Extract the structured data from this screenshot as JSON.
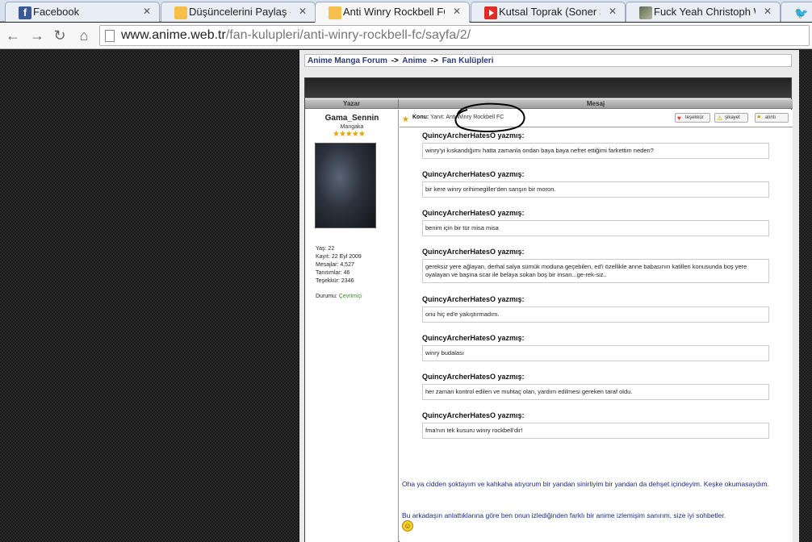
{
  "tabs": [
    {
      "title": "Facebook",
      "icon": "facebook-icon",
      "active": false
    },
    {
      "title": "Düşüncelerini Paylaş - Kor",
      "icon": "anime-site-icon",
      "active": false
    },
    {
      "title": "Anti Winry Rockbell FC - F",
      "icon": "anime-site-icon",
      "active": true
    },
    {
      "title": "Kutsal Toprak (Soner Sarık",
      "icon": "youtube-icon",
      "active": false
    },
    {
      "title": "Fuck Yeah Christoph Walt",
      "icon": "photo-favicon",
      "active": false
    },
    {
      "title": "",
      "icon": "twitter-icon",
      "active": false
    }
  ],
  "address": {
    "host": "www.anime.web.tr",
    "path": "/fan-kulupleri/anti-winry-rockbell-fc/sayfa/2/"
  },
  "breadcrumb": {
    "items": [
      "Anime Manga Forum",
      "Anime",
      "Fan Kulüpleri"
    ],
    "separator": "->"
  },
  "table": {
    "author_header": "Yazar",
    "message_header": "Mesaj"
  },
  "author": {
    "name": "Gama_Sennin",
    "rank": "Mangaka",
    "stars": "★★★★★",
    "stats": [
      "Yaş: 22",
      "Kayıt: 22 Eyl 2009",
      "Mesajlar: 4,527",
      "Tanıtımlar: 46",
      "Teşekkür: 2346"
    ],
    "status_label": "Durumu:",
    "status_value": "Çevrimiçi"
  },
  "post": {
    "subject_label": "Konu:",
    "subject_text": "Yanıt: Anti Winry Rockbell FC",
    "buttons": {
      "thanks": "teşekkür",
      "report": "şikayet",
      "quote": "alıntı"
    },
    "quotes": [
      {
        "author": "QuincyArcherHatesO yazmış:",
        "text": "winry'yi kıskandığımı hatta zamanla ondan baya baya nefret ettiğimi farkettim neden?"
      },
      {
        "author": "QuincyArcherHatesO yazmış:",
        "text": "bir kere winry orihimegiller'den sarışın bir moron."
      },
      {
        "author": "QuincyArcherHatesO yazmış:",
        "text": "benim için bir tür misa misa"
      },
      {
        "author": "QuincyArcherHatesO yazmış:",
        "text": "gereksiz yere ağlayan, derhal salya sümük moduna geçebilen, ed'i özellikle anne babasının katilleri konusunda boş yere oyalayan ve başına scar ile belaya sokan boş bir insan...ge-rek-siz.."
      },
      {
        "author": "QuincyArcherHatesO yazmış:",
        "text": "onu hiç ed'e yakıştırmadım."
      },
      {
        "author": "QuincyArcherHatesO yazmış:",
        "text": "winry budalası"
      },
      {
        "author": "QuincyArcherHatesO yazmış:",
        "text": "her zaman kontrol edilen ve muhtaç olan, yardım edilmesi gereken taraf oldu."
      },
      {
        "author": "QuincyArcherHatesO yazmış:",
        "text": "fma'nın tek kusuru winry rockbell'dir!"
      }
    ],
    "reply_lines": [
      "Oha ya cidden şoktayım ve kahkaha atıyorum bir yandan sinirliyim bir yandan da dehşet içindeyim. Keşke okumasaydım.",
      "Bu arkadaşın anlattıklarına göre ben onun izlediğinden farklı bir anime izlemişim sanırım, size iyi sohbetler."
    ]
  }
}
